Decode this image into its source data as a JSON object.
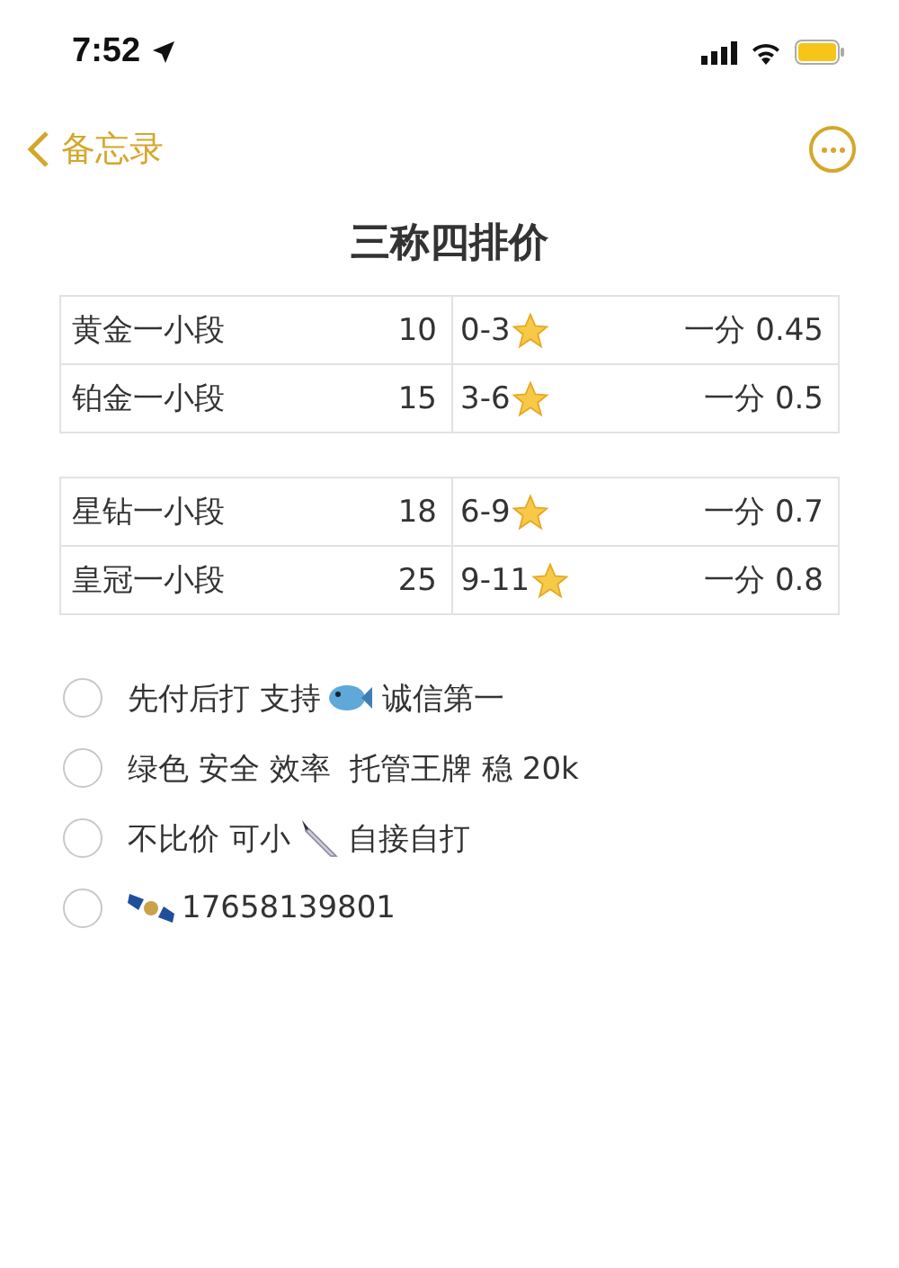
{
  "status_bar": {
    "time": "7:52"
  },
  "nav": {
    "back": "备忘录"
  },
  "title": "三称四排价",
  "tables": [
    {
      "rows": [
        {
          "tier": "黄金一小段",
          "price": "10",
          "range": "0-3",
          "rate": "一分 0.45"
        },
        {
          "tier": "铂金一小段",
          "price": "15",
          "range": "3-6",
          "rate": "一分 0.5"
        }
      ]
    },
    {
      "rows": [
        {
          "tier": "星钻一小段",
          "price": "18",
          "range": "6-9",
          "rate": "一分 0.7"
        },
        {
          "tier": "皇冠一小段",
          "price": "25",
          "range": "9-11",
          "rate": "一分 0.8"
        }
      ]
    }
  ],
  "checklist": [
    {
      "checked": false,
      "parts": [
        {
          "kind": "text",
          "text": "先付后打 支持"
        },
        {
          "kind": "fish"
        },
        {
          "kind": "text",
          "text": "诚信第一"
        }
      ]
    },
    {
      "checked": false,
      "parts": [
        {
          "kind": "text",
          "text": "绿色 安全 效率  托管王牌 稳 20k"
        }
      ]
    },
    {
      "checked": false,
      "parts": [
        {
          "kind": "text",
          "text": "不比价 可小"
        },
        {
          "kind": "knife"
        },
        {
          "kind": "text",
          "text": "自接自打"
        }
      ]
    },
    {
      "checked": false,
      "parts": [
        {
          "kind": "satellite"
        },
        {
          "kind": "text",
          "text": "17658139801"
        }
      ]
    }
  ]
}
